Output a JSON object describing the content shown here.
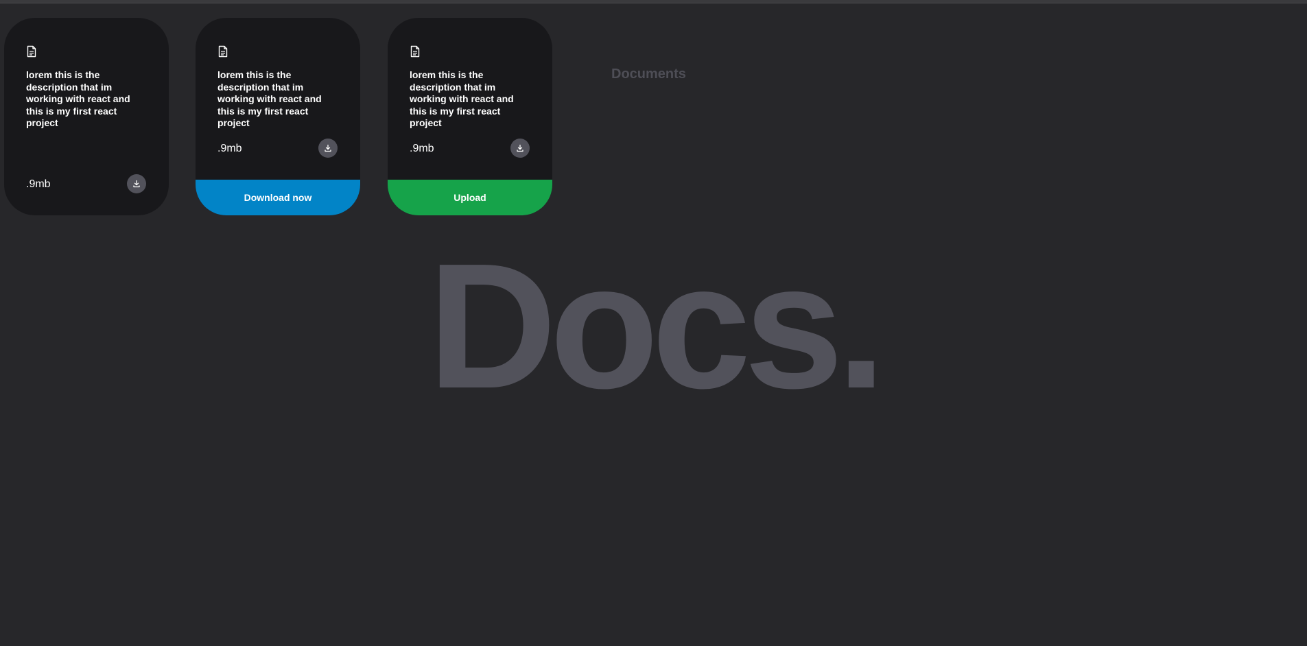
{
  "page": {
    "section_label": "Documents",
    "background_title": "Docs."
  },
  "colors": {
    "background": "#27272a",
    "card": "#18181b",
    "icon_button": "#52525b",
    "download_tag": "#0284c7",
    "upload_tag": "#16a34a"
  },
  "cards": [
    {
      "icon": "file-text-icon",
      "description": "lorem this is the description that im working with react and this is my first react project",
      "size": ".9mb",
      "action_icon": "download-icon"
    },
    {
      "icon": "file-text-icon",
      "description": "lorem this is the description that im working with react and this is my first react project",
      "size": ".9mb",
      "action_icon": "download-icon",
      "tag": {
        "label": "Download now",
        "color": "#0284c7"
      }
    },
    {
      "icon": "file-text-icon",
      "description": "lorem this is the description that im working with react and this is my first react project",
      "size": ".9mb",
      "action_icon": "download-icon",
      "tag": {
        "label": "Upload",
        "color": "#16a34a"
      }
    }
  ]
}
